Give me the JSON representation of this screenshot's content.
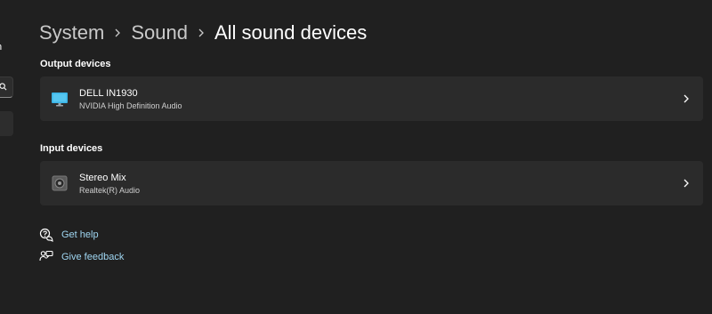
{
  "sidebar": {
    "partial_text": "n",
    "search_icon": "search-icon"
  },
  "breadcrumb": {
    "items": [
      "System",
      "Sound"
    ],
    "current": "All sound devices",
    "separator_icon": "chevron-right-icon"
  },
  "output_section": {
    "title": "Output devices",
    "devices": [
      {
        "name": "DELL IN1930",
        "subtitle": "NVIDIA High Definition Audio",
        "icon": "monitor-icon"
      }
    ]
  },
  "input_section": {
    "title": "Input devices",
    "devices": [
      {
        "name": "Stereo Mix",
        "subtitle": "Realtek(R) Audio",
        "icon": "speaker-icon"
      }
    ]
  },
  "links": [
    {
      "label": "Get help",
      "icon": "help-chat-icon"
    },
    {
      "label": "Give feedback",
      "icon": "feedback-icon"
    }
  ],
  "colors": {
    "background": "#202020",
    "card": "#2b2b2b",
    "link": "#9fd6f2",
    "monitor_accent": "#3ab4e6"
  }
}
